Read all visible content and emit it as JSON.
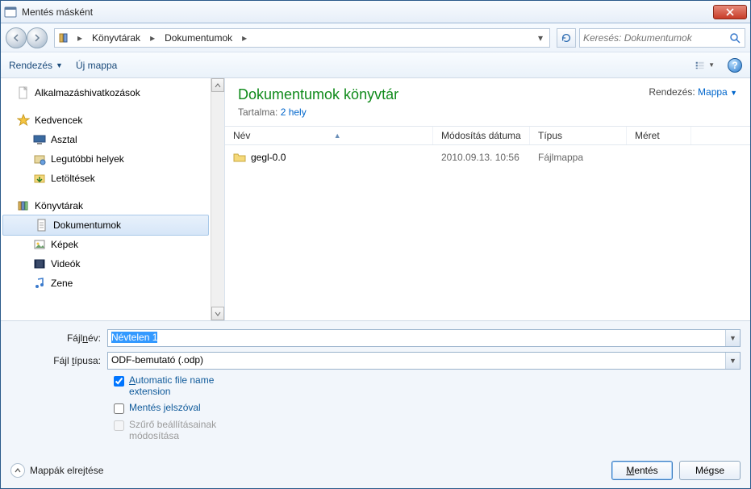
{
  "window": {
    "title": "Mentés másként"
  },
  "breadcrumb": {
    "items": [
      "Könyvtárak",
      "Dokumentumok"
    ]
  },
  "search": {
    "placeholder": "Keresés: Dokumentumok"
  },
  "toolbar": {
    "organize": "Rendezés",
    "newfolder": "Új mappa"
  },
  "sidebar": {
    "app_links": "Alkalmazáshivatkozások",
    "favorites": "Kedvencek",
    "desktop": "Asztal",
    "recent": "Legutóbbi helyek",
    "downloads": "Letöltések",
    "libraries": "Könyvtárak",
    "documents": "Dokumentumok",
    "pictures": "Képek",
    "videos": "Videók",
    "music": "Zene"
  },
  "content": {
    "header_title": "Dokumentumok könyvtár",
    "header_sub_prefix": "Tartalma: ",
    "header_sub_link": "2 hely",
    "sort_label": "Rendezés:",
    "sort_value": "Mappa",
    "columns": {
      "name": "Név",
      "date": "Módosítás dátuma",
      "type": "Típus",
      "size": "Méret"
    },
    "rows": [
      {
        "name": "gegl-0.0",
        "date": "2010.09.13. 10:56",
        "type": "Fájlmappa",
        "size": ""
      }
    ]
  },
  "filename": {
    "label_pre": "Fájl",
    "label_u": "n",
    "label_post": "év:",
    "value": "Névtelen 1"
  },
  "filetype": {
    "label_pre": "Fájl ",
    "label_u": "t",
    "label_post": "ípusa:",
    "value": "ODF-bemutató (.odp)"
  },
  "checks": {
    "auto_ext_u": "A",
    "auto_ext_rest": "utomatic file name extension",
    "pwd_pre": "Mentés ",
    "pwd_u": "j",
    "pwd_post": "elszóval",
    "filter": "Szűrő beállításainak módosítása"
  },
  "footer": {
    "hide": "Mappák elrejtése",
    "save_u": "M",
    "save_rest": "entés",
    "cancel": "Mégse"
  }
}
